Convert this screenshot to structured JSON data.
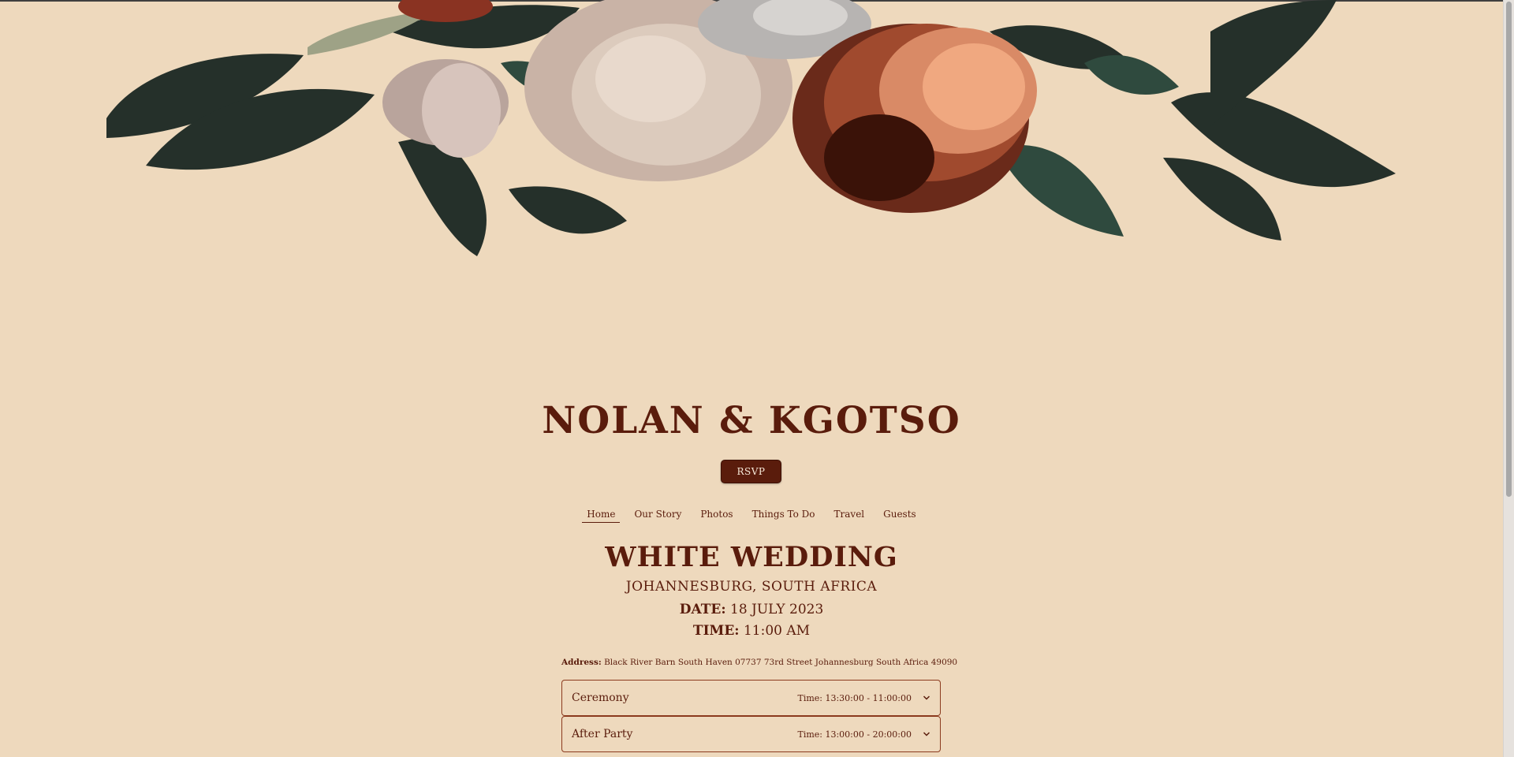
{
  "hero": {
    "couple_title": "NOLAN & KGOTSO",
    "rsvp_label": "RSVP"
  },
  "nav": {
    "items": [
      {
        "label": "Home",
        "active": true
      },
      {
        "label": "Our Story",
        "active": false
      },
      {
        "label": "Photos",
        "active": false
      },
      {
        "label": "Things To Do",
        "active": false
      },
      {
        "label": "Travel",
        "active": false
      },
      {
        "label": "Guests",
        "active": false
      }
    ]
  },
  "event": {
    "title": "WHITE WEDDING",
    "location": "JOHANNESBURG, SOUTH AFRICA",
    "date_label": "DATE:",
    "date_value": "18 JULY 2023",
    "time_label": "TIME:",
    "time_value": "11:00 AM",
    "address_label": "Address:",
    "address_value": "Black River Barn South Haven 07737 73rd Street Johannesburg South Africa 49090"
  },
  "schedule": [
    {
      "name": "Ceremony",
      "time": "Time: 13:30:00 - 11:00:00"
    },
    {
      "name": "After Party",
      "time": "Time: 13:00:00 - 20:00:00"
    }
  ],
  "icons": {
    "chevron": "chevron-down-icon"
  },
  "colors": {
    "background": "#eed9bd",
    "accent": "#5a1c0c"
  }
}
